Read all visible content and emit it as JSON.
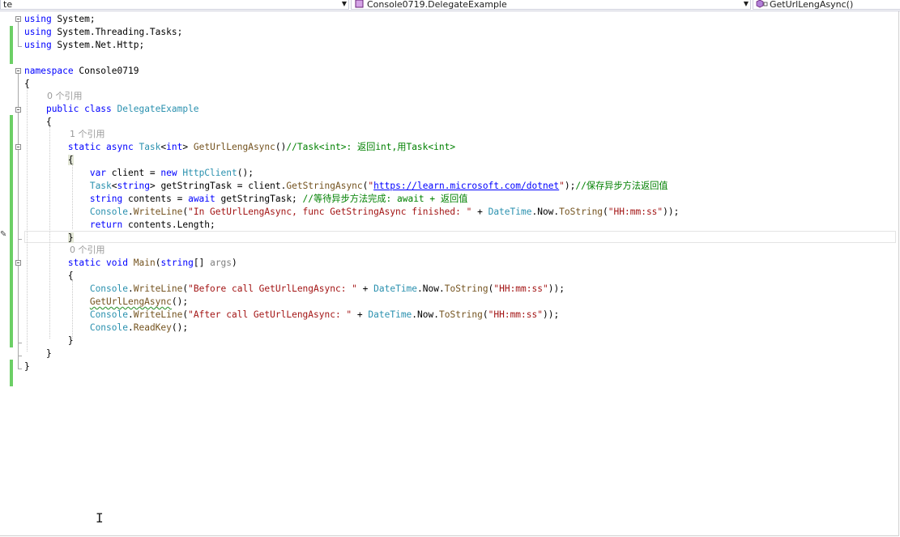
{
  "navbar": {
    "project": "te",
    "type": "Console0719.DelegateExample",
    "member": "GetUrlLengAsync()",
    "type_icon": "class-icon",
    "member_icon": "method-icon"
  },
  "code": {
    "l1_kw": "using",
    "l1_rest": " System;",
    "l2_kw": "using",
    "l2_rest": " System.Threading.Tasks;",
    "l3_kw": "using",
    "l3_rest": " System.Net.Http;",
    "ns_kw": "namespace",
    "ns_name": " Console0719",
    "open1": "{",
    "refs_class": "0 个引用",
    "class_kw": "public class ",
    "class_name": "DelegateExample",
    "open2": "{",
    "refs_method1": "1 个引用",
    "m1_kw": "static async ",
    "m1_task": "Task",
    "m1_lt": "<",
    "m1_int": "int",
    "m1_gt": "> ",
    "m1_name": "GetUrlLengAsync",
    "m1_parens": "()",
    "m1_comment": "//Task<int>: 返回int,用Task<int>",
    "open3": "{",
    "a_var": "var",
    "a_mid": " client = ",
    "a_new": "new",
    "a_type": " HttpClient",
    "a_end": "();",
    "b_task": "Task",
    "b_lt": "<",
    "b_str": "string",
    "b_gt": ">",
    "b_mid": " getStringTask = client.",
    "b_method": "GetStringAsync",
    "b_open": "(",
    "b_q1": "\"",
    "b_url": "https://learn.microsoft.com/dotnet",
    "b_q2": "\"",
    "b_close": ");",
    "b_comment": "//保存异步方法返回值",
    "c_kw": "string",
    "c_mid": " contents = ",
    "c_await": "await",
    "c_rest": " getStringTask; ",
    "c_comment": "//等待异步方法完成: await + 返回值",
    "d_console": "Console",
    "d_dot": ".",
    "d_write": "WriteLine",
    "d_open": "(",
    "d_str": "\"In GetUrlLengAsync, func GetStringAsync finished: \"",
    "d_plus": " + ",
    "d_dt": "DateTime",
    "d_now": ".Now.",
    "d_tostr": "ToString",
    "d_open2": "(",
    "d_fmt": "\"HH:mm:ss\"",
    "d_close": "));",
    "e_kw": "return",
    "e_rest": " contents.Length;",
    "close3": "}",
    "refs_main": "0 个引用",
    "main_kw1": "static ",
    "main_kw2": "void ",
    "main_name": "Main",
    "main_open": "(",
    "main_str": "string",
    "main_arr": "[] ",
    "main_args": "args",
    "main_close": ")",
    "open4": "{",
    "f_console": "Console",
    "f_dot": ".",
    "f_write": "WriteLine",
    "f_open": "(",
    "f_str": "\"Before call GetUrlLengAsync: \"",
    "f_plus": " + ",
    "f_dt": "DateTime",
    "f_now": ".Now.",
    "f_tostr": "ToString",
    "f_open2": "(",
    "f_fmt": "\"HH:mm:ss\"",
    "f_close": "));",
    "g_call": "GetUrlLengAsync",
    "g_end": "();",
    "h_console": "Console",
    "h_dot": ".",
    "h_write": "WriteLine",
    "h_open": "(",
    "h_str": "\"After call GetUrlLengAsync: \"",
    "h_plus": " + ",
    "h_dt": "DateTime",
    "h_now": ".Now.",
    "h_tostr": "ToString",
    "h_open2": "(",
    "h_fmt": "\"HH:mm:ss\"",
    "h_close": "));",
    "i_console": "Console",
    "i_dot": ".",
    "i_read": "ReadKey",
    "i_end": "();",
    "close4": "}",
    "close2": "}",
    "close1": "}"
  },
  "colors": {
    "keyword": "#0000ff",
    "type": "#2b91af",
    "method": "#74531f",
    "string": "#a31515",
    "comment": "#008000",
    "change_bar": "#6ccf66"
  }
}
